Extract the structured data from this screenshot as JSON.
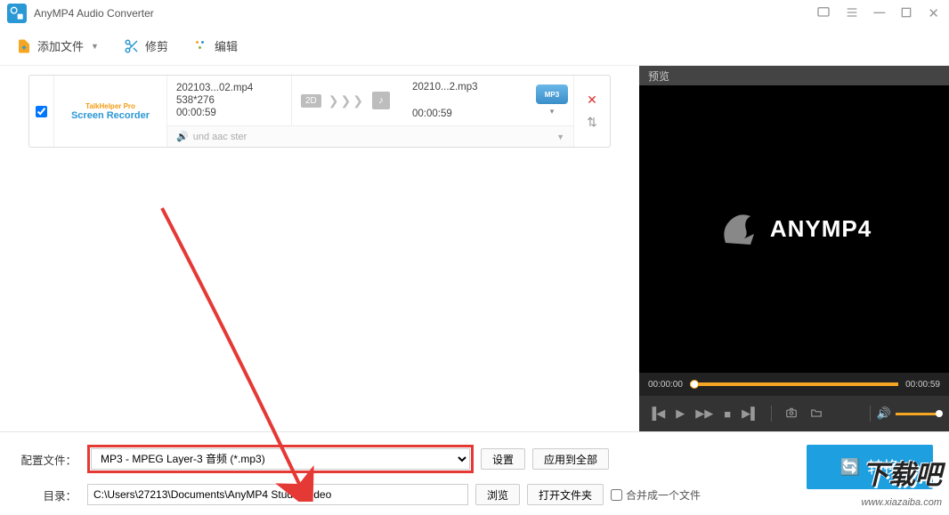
{
  "header": {
    "title": "AnyMP4 Audio Converter"
  },
  "toolbar": {
    "add_file": "添加文件",
    "trim": "修剪",
    "edit": "编辑"
  },
  "file_item": {
    "thumb_line1": "TalkHelper Pro",
    "thumb_line2": "Screen Recorder",
    "src_name": "202103...02.mp4",
    "src_res": "538*276",
    "src_dur": "00:00:59",
    "badge_2d": "2D",
    "dst_name": "20210...2.mp3",
    "dst_dur": "00:00:59",
    "fmt_label": "MP3",
    "audio_info": "und aac ster"
  },
  "preview": {
    "head": "预览",
    "brand": "ANYMP4",
    "time_cur": "00:00:00",
    "time_total": "00:00:59"
  },
  "bottom": {
    "profile_label": "配置文件：",
    "profile_value": "MP3 - MPEG Layer-3 音频 (*.mp3)",
    "settings": "设置",
    "apply_all": "应用到全部",
    "dir_label": "目录：",
    "dir_value": "C:\\Users\\27213\\Documents\\AnyMP4 Studio\\Video",
    "browse": "浏览",
    "open_folder": "打开文件夹",
    "merge": "合并成一个文件",
    "convert": "转换"
  },
  "watermark": {
    "big": "下载吧",
    "small": "www.xiazaiba.com"
  }
}
